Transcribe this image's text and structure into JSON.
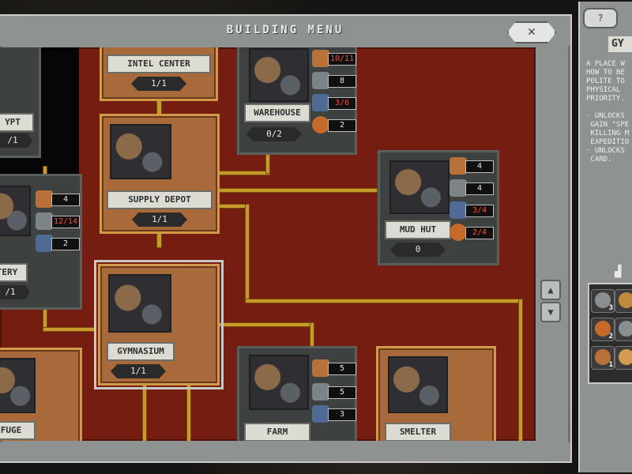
{
  "window": {
    "title": "BUILDING MENU",
    "close_icon": "✕"
  },
  "colors": {
    "map_bg": "#761d12",
    "road": "#c99a29",
    "panel": "#8e9291"
  },
  "buildings": {
    "intel_center": {
      "label": "INTEL CENTER",
      "count": "1/1"
    },
    "crypt": {
      "label": "YPT",
      "count": "/1"
    },
    "supply_depot": {
      "label": "SUPPLY DEPOT",
      "count": "1/1"
    },
    "warehouse": {
      "label": "WAREHOUSE",
      "count": "0/2",
      "costs": [
        "10/11",
        "8",
        "3/6",
        "2"
      ]
    },
    "cemetery": {
      "label": "TERY",
      "count": "/1",
      "costs": [
        "4",
        "12/14",
        "2"
      ]
    },
    "mud_hut": {
      "label": "MUD HUT",
      "count": "0",
      "costs": [
        "4",
        "4",
        "3/4",
        "2/4"
      ]
    },
    "gymnasium": {
      "label": "GYMNASIUM",
      "count": "1/1"
    },
    "refuge": {
      "label": "FUGE"
    },
    "farm": {
      "label": "FARM",
      "costs": [
        "5",
        "5",
        "3"
      ]
    },
    "smelter": {
      "label": "SMELTER"
    }
  },
  "side_panel": {
    "tab_icon": "?",
    "title": "GY",
    "description": "A PLACE W\nHOW TO BE\nPOLITE TO\nPHYSICAL\nPRIORITY.\n\n· UNLOCKS\n GAIN \"SPE\n KILLING M\n EXPEDITIO\n· UNLOCKS\n CARD.",
    "inventory": [
      {
        "count": "3"
      },
      {
        "count": ""
      },
      {
        "count": "2"
      },
      {
        "count": ""
      },
      {
        "count": "1"
      },
      {
        "count": ""
      }
    ]
  }
}
